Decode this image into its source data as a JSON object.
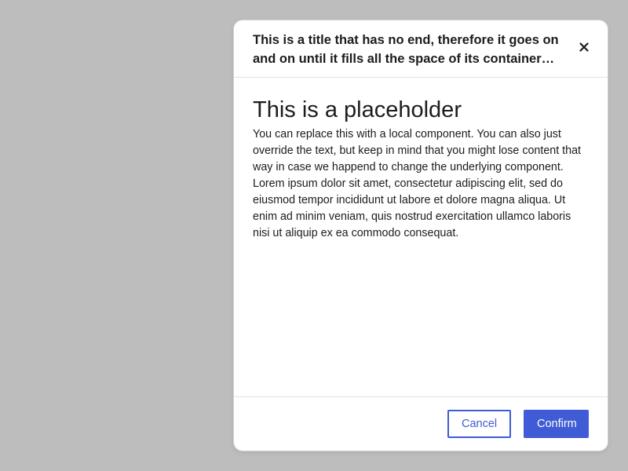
{
  "dialog": {
    "title": "This is a title that has no end, therefore it goes on and on until it fills all the space of its container and then some more text to overflow",
    "close_icon": "close-icon",
    "heading": "This is a placeholder",
    "body": "You can replace this with a local component. You can also just override the text, but keep in mind that you might lose content that way in case we happend to change the underlying component. Lorem ipsum dolor sit amet, consectetur adipiscing elit, sed do eiusmod tempor incididunt ut labore et dolore magna aliqua. Ut enim ad minim veniam, quis nostrud exercitation ullamco laboris nisi ut aliquip ex ea commodo consequat.",
    "cancel_label": "Cancel",
    "confirm_label": "Confirm"
  },
  "colors": {
    "backdrop": "#bdbdbd",
    "accent": "#3f5bd5",
    "surface": "#ffffff",
    "text": "#1c1c1c"
  }
}
